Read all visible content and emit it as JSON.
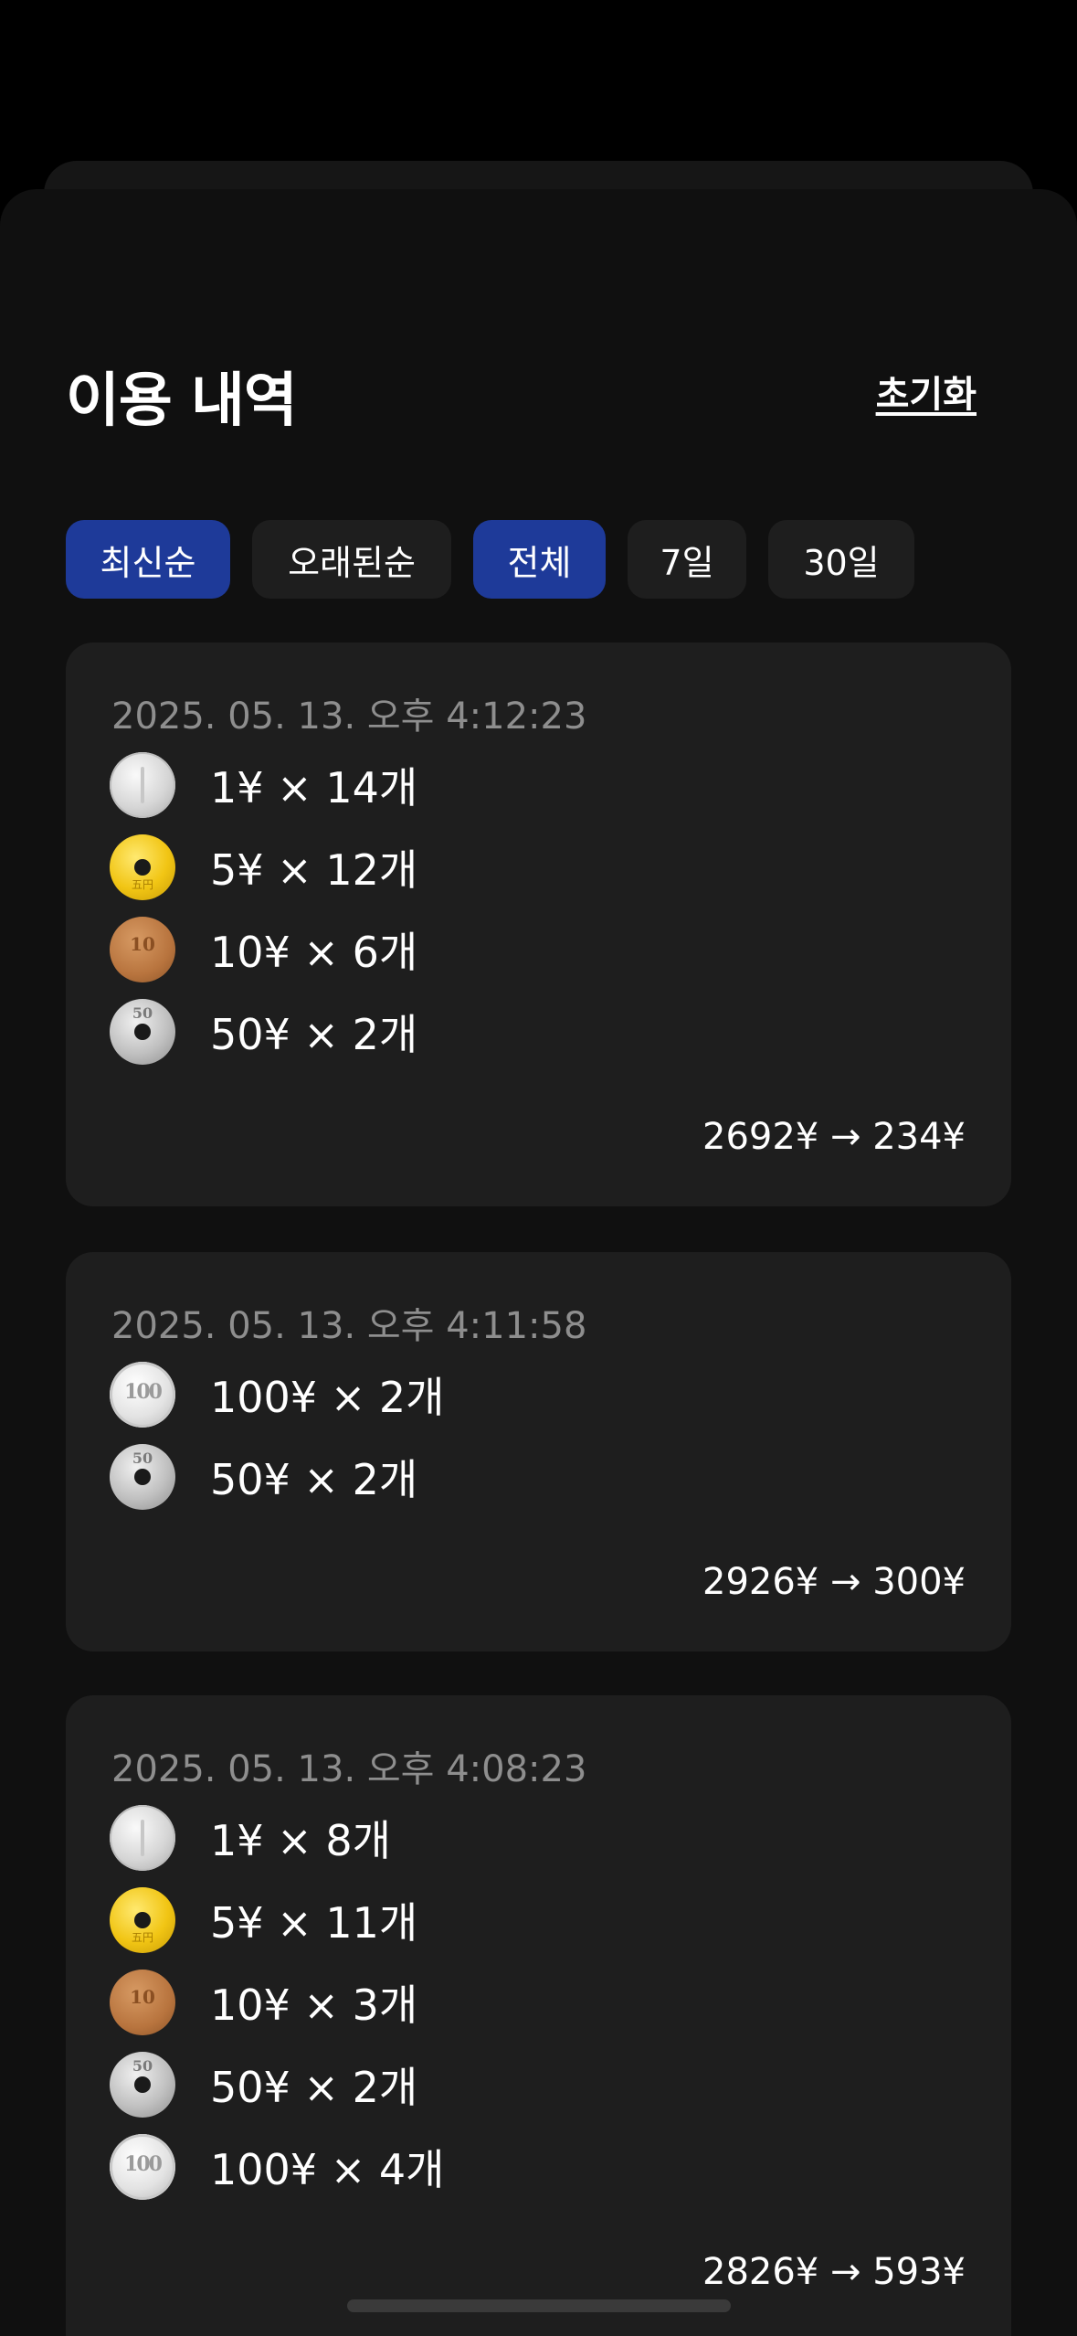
{
  "header": {
    "title": "이용 내역",
    "reset_label": "초기화"
  },
  "filters": {
    "sort": [
      {
        "label": "최신순",
        "active": true
      },
      {
        "label": "오래된순",
        "active": false
      }
    ],
    "range": [
      {
        "label": "전체",
        "active": true
      },
      {
        "label": "7일",
        "active": false
      },
      {
        "label": "30일",
        "active": false
      }
    ]
  },
  "records": [
    {
      "date": "2025. 05. 13. 오후 4:12:23",
      "coins": [
        {
          "denom": "1",
          "label": "1¥ × 14개",
          "icon": "coin-1yen-icon"
        },
        {
          "denom": "5",
          "label": "5¥ × 12개",
          "icon": "coin-5yen-icon"
        },
        {
          "denom": "10",
          "label": "10¥ × 6개",
          "icon": "coin-10yen-icon"
        },
        {
          "denom": "50",
          "label": "50¥ × 2개",
          "icon": "coin-50yen-icon"
        }
      ],
      "total": "2692¥ → 234¥"
    },
    {
      "date": "2025. 05. 13. 오후 4:11:58",
      "coins": [
        {
          "denom": "100",
          "label": "100¥ × 2개",
          "icon": "coin-100yen-icon"
        },
        {
          "denom": "50",
          "label": "50¥ × 2개",
          "icon": "coin-50yen-icon"
        }
      ],
      "total": "2926¥ → 300¥"
    },
    {
      "date": "2025. 05. 13. 오후 4:08:23",
      "coins": [
        {
          "denom": "1",
          "label": "1¥ × 8개",
          "icon": "coin-1yen-icon"
        },
        {
          "denom": "5",
          "label": "5¥ × 11개",
          "icon": "coin-5yen-icon"
        },
        {
          "denom": "10",
          "label": "10¥ × 3개",
          "icon": "coin-10yen-icon"
        },
        {
          "denom": "50",
          "label": "50¥ × 2개",
          "icon": "coin-50yen-icon"
        },
        {
          "denom": "100",
          "label": "100¥ × 4개",
          "icon": "coin-100yen-icon"
        }
      ],
      "total": "2826¥ → 593¥"
    }
  ],
  "colors": {
    "background": "#101010",
    "card": "#1e1e1e",
    "chip": "#1e1e1e",
    "chip_active": "#1e3a99",
    "date_text": "#8e8e8e",
    "text": "#ffffff"
  }
}
